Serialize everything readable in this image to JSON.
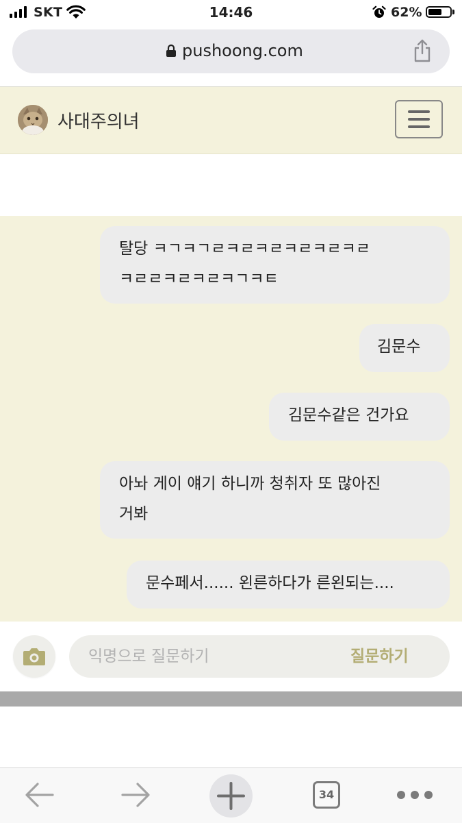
{
  "status_bar": {
    "carrier": "SKT",
    "time": "14:46",
    "battery_percent": "62%",
    "battery_level": 0.62,
    "icons": [
      "signal-icon",
      "wifi-icon",
      "alarm-icon",
      "battery-icon"
    ]
  },
  "browser": {
    "url": "pushoong.com",
    "tab_count": "34",
    "toolbar_icons": [
      "back-arrow-icon",
      "forward-arrow-icon",
      "new-tab-plus-icon",
      "tabs-icon",
      "more-icon"
    ]
  },
  "site": {
    "title": "사대주의녀",
    "menu_icon": "hamburger-icon"
  },
  "messages": [
    {
      "text": "탈당 ㅋㄱㅋㄱㄹㅋㄹㅋㄹㅋㄹㅋㄹㅋㄹ\nㅋㄹㄹㅋㄹㅋㄹㅋㄱㅋㅌ"
    },
    {
      "text": "김문수"
    },
    {
      "text": "김문수같은 건가요"
    },
    {
      "text": "아놔 게이 얘기 하니까 청취자 또 많아진\n거봐"
    },
    {
      "text": "문수페서...... 왼른하다가 른왼되는...."
    }
  ],
  "composer": {
    "placeholder": "익명으로 질문하기",
    "submit_label": "질문하기",
    "camera_icon": "camera-icon"
  },
  "colors": {
    "accent": "#b3ad74",
    "chat_background": "#f4f2dc",
    "bubble": "#ececec"
  }
}
